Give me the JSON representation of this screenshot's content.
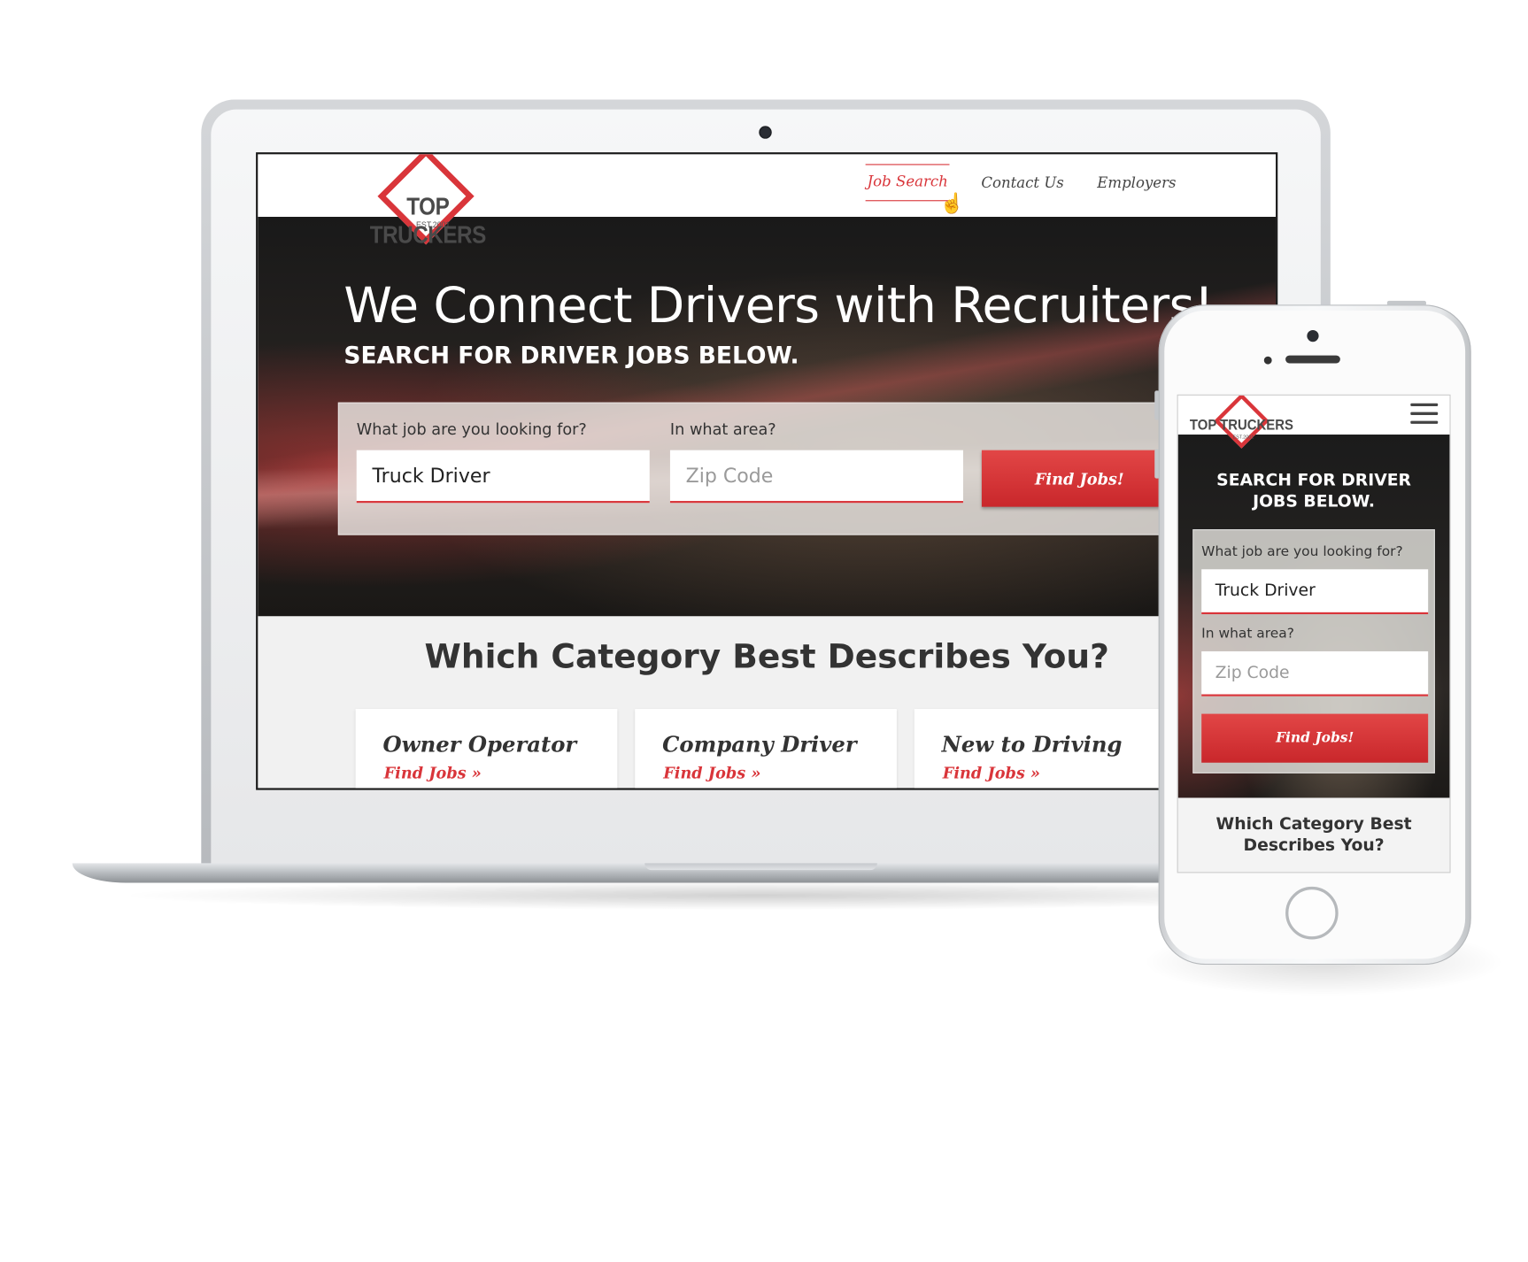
{
  "brand": {
    "name": "TOP TRUCKERS",
    "est": "EST.2001",
    "accent": "#d9353a"
  },
  "nav": {
    "items": [
      "Job Search",
      "Contact Us",
      "Employers"
    ],
    "active": "Job Search"
  },
  "hero": {
    "title": "We Connect Drivers with Recruiters!",
    "subtitle": "SEARCH FOR DRIVER JOBS BELOW."
  },
  "search": {
    "job_label": "What job are you looking for?",
    "job_value": "Truck Driver",
    "area_label": "In what area?",
    "area_placeholder": "Zip Code",
    "button": "Find Jobs!"
  },
  "categories": {
    "title": "Which Category Best Describes You?",
    "items": [
      {
        "name": "Owner Operator",
        "link": "Find Jobs »"
      },
      {
        "name": "Company Driver",
        "link": "Find Jobs »"
      },
      {
        "name": "New to Driving",
        "link": "Find Jobs »"
      }
    ]
  },
  "mobile": {
    "subtitle_line1": "SEARCH FOR DRIVER",
    "subtitle_line2": "JOBS BELOW.",
    "category_line1": "Which Category Best",
    "category_line2": "Describes You?",
    "menu_icon": "hamburger-menu-icon"
  }
}
